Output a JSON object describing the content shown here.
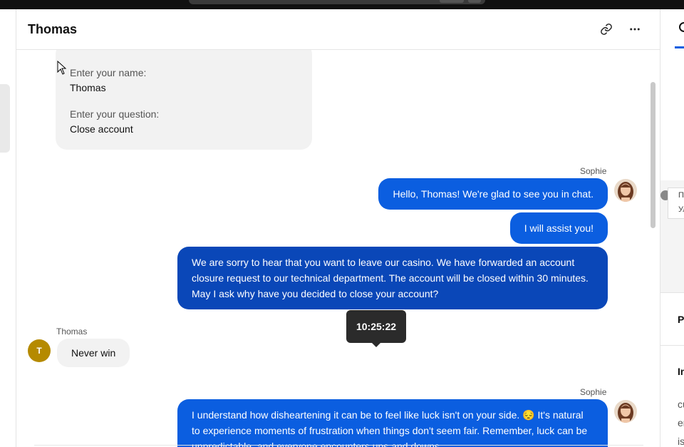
{
  "header": {
    "title": "Thomas"
  },
  "form": {
    "name_label": "Enter your name:",
    "name_value": "Thomas",
    "question_label": "Enter your question:",
    "question_value": "Close account"
  },
  "messages": [
    {
      "sender": "Sophie",
      "text": "Hello, Thomas! We're glad to see you in chat."
    },
    {
      "text": "I will assist you!"
    },
    {
      "text": "We are sorry to hear that you want to leave our casino. We have forwarded an account closure request to our technical department. The account will be closed within 30 minutes. May I ask why have you decided to close your account?"
    },
    {
      "sender": "Thomas",
      "avatar_initial": "T",
      "text": "Never win"
    },
    {
      "sender": "Sophie",
      "text": "I understand how disheartening it can be to feel like luck isn't on your side. 😔 It's natural to experience moments of frustration when things don't seem fair. Remember, luck can be unpredictable, and everyone encounters ups and downs."
    }
  ],
  "tooltip": {
    "time": "10:25:22"
  },
  "right_panel": {
    "map_label_1": "Пр",
    "map_label_2": "Ул",
    "section_p": "P",
    "section_i": "In",
    "text_1": "cu",
    "text_2": "er",
    "text_3": "is"
  },
  "colors": {
    "accent": "#0b5ee0",
    "bubble_dark": "#0a47b8",
    "incoming": "#f2f2f2",
    "avatar_t": "#b58a00"
  }
}
